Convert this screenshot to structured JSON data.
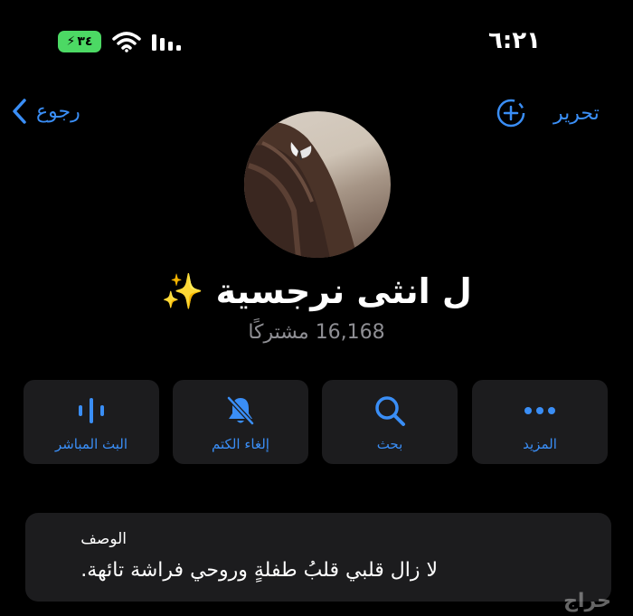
{
  "status_bar": {
    "time": "٦:٢١",
    "battery": "٣٤",
    "icons": [
      "battery-icon",
      "wifi-icon",
      "cellular-signal-icon"
    ]
  },
  "nav": {
    "back_label": "رجوع",
    "edit_label": "تحرير",
    "icons": [
      "chevron-left-icon",
      "add-circle-icon"
    ]
  },
  "channel": {
    "name": "ل انثى نرجسية ✨",
    "subscribers": "16,168 مشتركًا"
  },
  "actions": [
    {
      "label": "البث المباشر",
      "icon": "waveform-icon"
    },
    {
      "label": "إلغاء الكتم",
      "icon": "bell-slash-icon"
    },
    {
      "label": "بحث",
      "icon": "search-icon"
    },
    {
      "label": "المزيد",
      "icon": "more-icon"
    }
  ],
  "description": {
    "label": "الوصف",
    "text": "لا زال قلبي قلبُ طفلةٍ وروحي فراشة تائهة."
  },
  "watermark": "حراج",
  "colors": {
    "background": "#000000",
    "card": "#1c1c1e",
    "accent": "#3a8ef6",
    "secondary_text": "#8e8e93",
    "battery": "#4cd964"
  }
}
